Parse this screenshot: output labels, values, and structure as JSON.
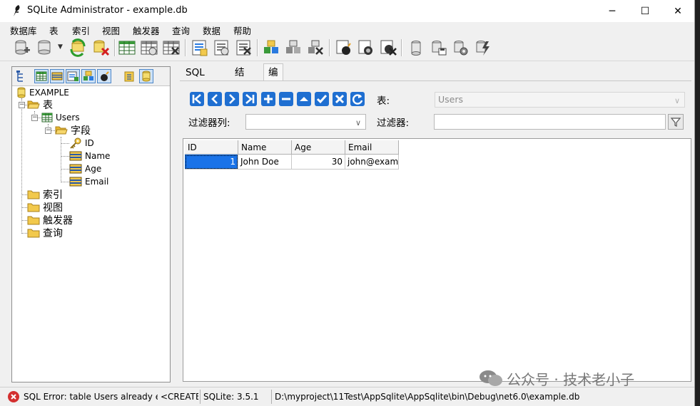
{
  "window": {
    "title": "SQLite Administrator - example.db"
  },
  "controls": {
    "minimize": "─",
    "maximize": "☐",
    "close": "✕"
  },
  "menu": [
    "数据库",
    "表",
    "索引",
    "视图",
    "触发器",
    "查询",
    "数据",
    "帮助"
  ],
  "tree": {
    "database": "EXAMPLE",
    "tables_folder": "表",
    "table": "Users",
    "fields_folder": "字段",
    "fields": [
      "ID",
      "Name",
      "Age",
      "Email"
    ],
    "folders": [
      "索引",
      "视图",
      "触发器",
      "查询"
    ]
  },
  "tabs": [
    "SQL 查询",
    "结果",
    "编辑数据"
  ],
  "edit": {
    "table_label": "表:",
    "table_value": "Users",
    "filter_column_label": "过滤器列:",
    "filter_column_value": "",
    "filter_label": "过滤器:",
    "filter_value": ""
  },
  "grid": {
    "columns": [
      "ID",
      "Name",
      "Age",
      "Email"
    ],
    "rows": [
      [
        "1",
        "John Doe",
        "30",
        "john@examp"
      ]
    ]
  },
  "status": {
    "error": "SQL Error: table Users already exists",
    "sql": "<CREATE TABLE",
    "version": "SQLite: 3.5.1",
    "path": "D:\\myproject\\11Test\\AppSqlite\\AppSqlite\\bin\\Debug\\net6.0\\example.db"
  },
  "watermark": "公众号 · 技术老小子",
  "colors": {
    "accent": "#1a73e8",
    "nav_blue": "#1f6fd1",
    "error": "#d32f2f",
    "folder": "#f2c94c"
  }
}
